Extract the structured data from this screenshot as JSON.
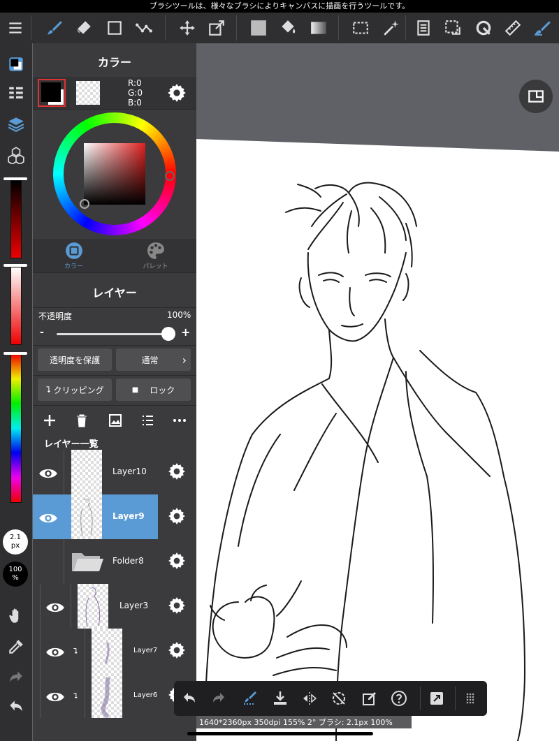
{
  "tooltip": "ブラシツールは、様々なブラシによりキャンバスに描画を行うツールです。",
  "status": "1640*2360px 350dpi 155% 2° ブラシ: 2.1px 100%",
  "brush_size": {
    "value": "2.1",
    "unit": "px"
  },
  "brush_opacity": {
    "value": "100",
    "unit": "%"
  },
  "color_panel": {
    "title": "カラー",
    "rgb": {
      "r": "R:0",
      "g": "G:0",
      "b": "B:0"
    },
    "tabs": [
      {
        "label": "カラー",
        "active": true
      },
      {
        "label": "パレット",
        "active": false
      }
    ],
    "foreground": "#000000",
    "accent": "#5b9bd5"
  },
  "layer_panel": {
    "title": "レイヤー",
    "opacity_label": "不透明度",
    "opacity_value": "100%",
    "minus": "-",
    "plus": "+",
    "protect_alpha": "透明度を保護",
    "blend_mode": "通常",
    "clipping": "クリッピング",
    "lock": "ロック",
    "list_title": "レイヤー一覧",
    "layers": [
      {
        "name": "Layer10",
        "visible": true,
        "selected": false
      },
      {
        "name": "Layer9",
        "visible": true,
        "selected": true
      },
      {
        "name": "Folder8",
        "visible": false,
        "selected": false
      },
      {
        "name": "Layer3",
        "visible": true,
        "selected": false
      },
      {
        "name": "Layer7",
        "visible": true,
        "selected": false
      },
      {
        "name": "Layer6",
        "visible": true,
        "selected": false
      }
    ]
  }
}
